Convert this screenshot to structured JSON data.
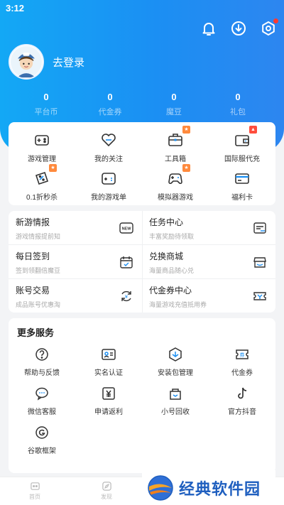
{
  "status_bar": {
    "time": "3:12"
  },
  "header": {
    "colors": {
      "gradient_start": "#13a8f5",
      "gradient_end": "#2d86f0"
    },
    "icons": [
      "bell-icon",
      "download-icon",
      "settings-icon"
    ],
    "login_text": "去登录"
  },
  "stats": [
    {
      "value": "0",
      "label": "平台币"
    },
    {
      "value": "0",
      "label": "代金券"
    },
    {
      "value": "0",
      "label": "魔豆"
    },
    {
      "value": "0",
      "label": "礼包"
    }
  ],
  "grid": [
    {
      "label": "游戏管理",
      "icon": "gamepad-icon"
    },
    {
      "label": "我的关注",
      "icon": "heart-icon"
    },
    {
      "label": "工具箱",
      "icon": "toolbox-icon"
    },
    {
      "label": "国际服代充",
      "icon": "wallet-icon"
    },
    {
      "label": "0.1折秒杀",
      "icon": "discount-icon"
    },
    {
      "label": "我的游戏单",
      "icon": "game-list-icon"
    },
    {
      "label": "模拟器游戏",
      "icon": "emulator-icon"
    },
    {
      "label": "福利卡",
      "icon": "card-icon"
    }
  ],
  "info": [
    {
      "title": "新游情报",
      "sub": "游戏情报提前知",
      "icon": "new-icon"
    },
    {
      "title": "任务中心",
      "sub": "丰富奖励待领取",
      "icon": "task-icon"
    },
    {
      "title": "每日签到",
      "sub": "签到领翻倍魔豆",
      "icon": "calendar-icon"
    },
    {
      "title": "兑换商城",
      "sub": "海量商品随心兑",
      "icon": "shop-icon"
    },
    {
      "title": "账号交易",
      "sub": "成品账号优惠淘",
      "icon": "trade-icon"
    },
    {
      "title": "代金券中心",
      "sub": "海量游戏充值抵用券",
      "icon": "coupon-icon"
    }
  ],
  "more_services": {
    "title": "更多服务",
    "items": [
      {
        "label": "帮助与反馈",
        "icon": "help-icon"
      },
      {
        "label": "实名认证",
        "icon": "id-card-icon"
      },
      {
        "label": "安装包管理",
        "icon": "package-icon"
      },
      {
        "label": "代金券",
        "icon": "voucher-icon"
      },
      {
        "label": "微信客服",
        "icon": "wechat-icon"
      },
      {
        "label": "申请返利",
        "icon": "rebate-icon"
      },
      {
        "label": "小号回收",
        "icon": "recycle-icon"
      },
      {
        "label": "官方抖音",
        "icon": "douyin-icon"
      },
      {
        "label": "谷歌框架",
        "icon": "google-icon"
      }
    ]
  },
  "bottom_nav": [
    {
      "label": "首页",
      "icon": "home-icon"
    },
    {
      "label": "发现",
      "icon": "discover-icon"
    }
  ],
  "watermark": {
    "text": "经典软件园"
  }
}
